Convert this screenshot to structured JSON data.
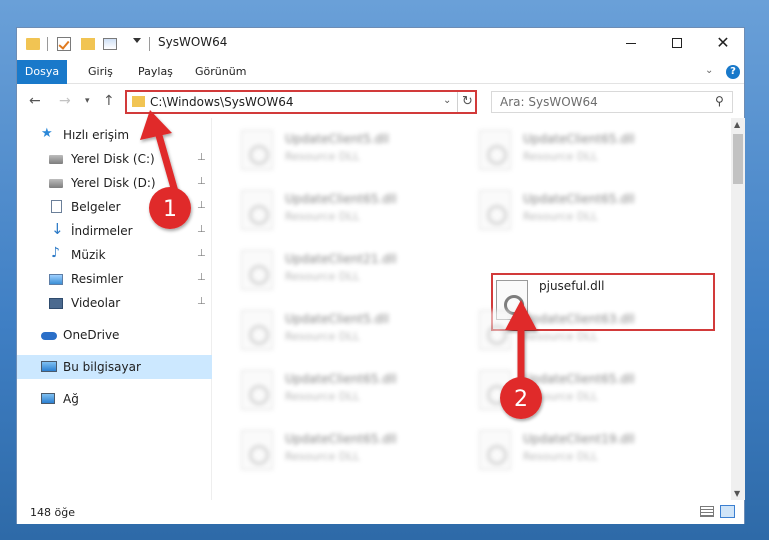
{
  "window": {
    "title": "SysWOW64",
    "controls": {
      "minimize": "—",
      "maximize": "☐",
      "close": "✕"
    }
  },
  "ribbon": {
    "tabs": [
      "Dosya",
      "Giriş",
      "Paylaş",
      "Görünüm"
    ],
    "help": "?"
  },
  "nav": {
    "back": "←",
    "forward": "→",
    "recent": "▾",
    "up": "↑"
  },
  "address": {
    "path": "C:\\Windows\\SysWOW64",
    "dropdown": "⌄",
    "refresh": "↻"
  },
  "search": {
    "placeholder": "Ara: SysWOW64",
    "icon": "⚲"
  },
  "sidebar": {
    "items": [
      {
        "label": "Hızlı erişim",
        "icon": "star-icon",
        "pinned": false
      },
      {
        "label": "Yerel Disk (C:)",
        "icon": "disk-icon",
        "pinned": true
      },
      {
        "label": "Yerel Disk (D:)",
        "icon": "disk-icon",
        "pinned": true
      },
      {
        "label": "Belgeler",
        "icon": "document-icon",
        "pinned": true
      },
      {
        "label": "İndirmeler",
        "icon": "download-icon",
        "pinned": true
      },
      {
        "label": "Müzik",
        "icon": "music-icon",
        "pinned": true
      },
      {
        "label": "Resimler",
        "icon": "pictures-icon",
        "pinned": true
      },
      {
        "label": "Videolar",
        "icon": "videos-icon",
        "pinned": true
      },
      {
        "label": "OneDrive",
        "icon": "cloud-icon",
        "pinned": false
      },
      {
        "label": "Bu bilgisayar",
        "icon": "computer-icon",
        "pinned": false,
        "selected": true
      },
      {
        "label": "Ağ",
        "icon": "network-icon",
        "pinned": false
      }
    ],
    "pin_glyph": "📌"
  },
  "files": [
    {
      "name": "UpdateClient5.dll",
      "desc": "Resource DLL"
    },
    {
      "name": "UpdateClient65.dll",
      "desc": "Resource DLL"
    },
    {
      "name": "UpdateClient65.dll",
      "desc": "Resource DLL"
    },
    {
      "name": "UpdateClient65.dll",
      "desc": "Resource DLL"
    },
    {
      "name": "UpdateClient21.dll",
      "desc": "Resource DLL"
    },
    {
      "name": "pjuseful.dll",
      "desc": "",
      "highlighted": true
    },
    {
      "name": "UpdateClient5.dll",
      "desc": "Resource DLL"
    },
    {
      "name": "UpdateClient63.dll",
      "desc": "Resource DLL"
    },
    {
      "name": "UpdateClient65.dll",
      "desc": "Resource DLL"
    },
    {
      "name": "UpdateClient65.dll",
      "desc": "Resource DLL"
    },
    {
      "name": "UpdateClient65.dll",
      "desc": "Resource DLL"
    },
    {
      "name": "UpdateClient19.dll",
      "desc": "Resource DLL"
    }
  ],
  "status": {
    "count": "148 öğe"
  },
  "annotations": {
    "badge1": "1",
    "badge2": "2",
    "color_highlight": "#d23a3a",
    "color_badge": "#e02b2b"
  }
}
